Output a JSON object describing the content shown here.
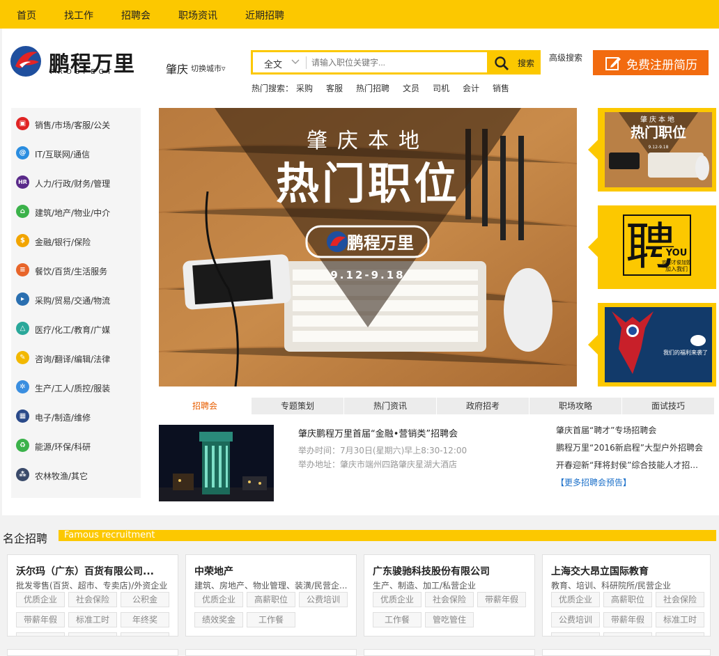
{
  "topnav": {
    "items": [
      "首页",
      "找工作",
      "招聘会",
      "职场资讯",
      "近期招聘"
    ]
  },
  "logo": {
    "cn": "鹏程万里",
    "en": "PROSPECT"
  },
  "city": {
    "name": "肇庆",
    "switch": "切换城市▿"
  },
  "search": {
    "type": "全文",
    "placeholder": "请输入职位关键字...",
    "button": "搜索",
    "advanced": "高级搜索"
  },
  "register": {
    "label": "免费注册简历"
  },
  "hot_search": {
    "label": "热门搜索：",
    "items": [
      "采购",
      "客服",
      "热门招聘",
      "文员",
      "司机",
      "会计",
      "销售"
    ]
  },
  "categories": [
    {
      "label": "销售/市场/客服/公关",
      "icon": "shopping-bag-icon",
      "color": "#e02424"
    },
    {
      "label": "IT/互联网/通信",
      "icon": "at-icon",
      "color": "#2a8de0"
    },
    {
      "label": "人力/行政/财务/管理",
      "icon": "hr-icon",
      "color": "#5a2a8a"
    },
    {
      "label": "建筑/地产/物业/中介",
      "icon": "house-icon",
      "color": "#3bb24a"
    },
    {
      "label": "金融/银行/保险",
      "icon": "dollar-icon",
      "color": "#f2a500"
    },
    {
      "label": "餐饮/百货/生活服务",
      "icon": "dining-icon",
      "color": "#e8652a"
    },
    {
      "label": "采购/贸易/交通/物流",
      "icon": "truck-icon",
      "color": "#2a6fb0"
    },
    {
      "label": "医疗/化工/教育/广媒",
      "icon": "flask-icon",
      "color": "#2aa89a"
    },
    {
      "label": "咨询/翻译/编辑/法律",
      "icon": "pencil-icon",
      "color": "#f2b800"
    },
    {
      "label": "生产/工人/质控/服装",
      "icon": "gear-icon",
      "color": "#3a8ee0"
    },
    {
      "label": "电子/制造/维修",
      "icon": "chip-icon",
      "color": "#2a4a8a"
    },
    {
      "label": "能源/环保/科研",
      "icon": "recycle-icon",
      "color": "#3bb24a"
    },
    {
      "label": "农林牧渔/其它",
      "icon": "network-icon",
      "color": "#3a4a6a"
    }
  ],
  "banner": {
    "line1": "肇庆本地",
    "line2": "热门职位",
    "brand": "鹏程万里",
    "date": "9.12-9.18"
  },
  "side_ads": [
    {
      "name": "hot-jobs-ad",
      "title": "肇庆本地",
      "headline": "热门职位",
      "date": "9.12-9.18"
    },
    {
      "name": "recruit-you-ad",
      "glyph": "聘",
      "you": "YOU",
      "sub": "欢迎才俊加盟",
      "sub2": "加入我们"
    },
    {
      "name": "welfare-ad",
      "text": "我们的福利来袭了"
    }
  ],
  "tabs": [
    "招聘会",
    "专题策划",
    "热门资讯",
    "政府招考",
    "职场攻略",
    "面试技巧"
  ],
  "job_fair": {
    "title": "肇庆鹏程万里首届“金融•营销类”招聘会",
    "time": "举办时间：7月30日(星期六)早上8:30-12:00",
    "place": "举办地址：肇庆市端州四路肇庆星湖大酒店",
    "links": [
      "肇庆首届“聘才”专场招聘会",
      "鹏程万里“2016新启程”大型户外招聘会",
      "开春迎新“拜将封侯”综合技能人才招..."
    ],
    "more": "【更多招聘会预告】"
  },
  "famous": {
    "title": "名企招聘",
    "subtitle": "Famous recruitment",
    "companies": [
      {
        "name": "沃尔玛（广东）百货有限公司...",
        "industry": "批发零售(百货、超市、专卖店)/外资企业",
        "tags": [
          "优质企业",
          "社会保险",
          "公积金",
          "带薪年假",
          "标准工时",
          "年终奖"
        ]
      },
      {
        "name": "中荣地产",
        "industry": "建筑、房地产、物业管理、装潢/民营企...",
        "tags": [
          "优质企业",
          "高薪职位",
          "公费培训",
          "绩效奖金",
          "工作餐"
        ]
      },
      {
        "name": "广东骏驰科技股份有限公司",
        "industry": "生产、制造、加工/私营企业",
        "tags": [
          "优质企业",
          "社会保险",
          "带薪年假",
          "工作餐",
          "管吃管住"
        ]
      },
      {
        "name": "上海交大昂立国际教育",
        "industry": "教育、培训、科研院所/民营企业",
        "tags": [
          "优质企业",
          "高薪职位",
          "社会保险",
          "公费培训",
          "带薪年假",
          "标准工时"
        ]
      }
    ]
  },
  "colors": {
    "brand_yellow": "#fcc800",
    "register_orange": "#f26b0f",
    "link_blue": "#1a6fc9",
    "tab_active": "#e85e00"
  }
}
